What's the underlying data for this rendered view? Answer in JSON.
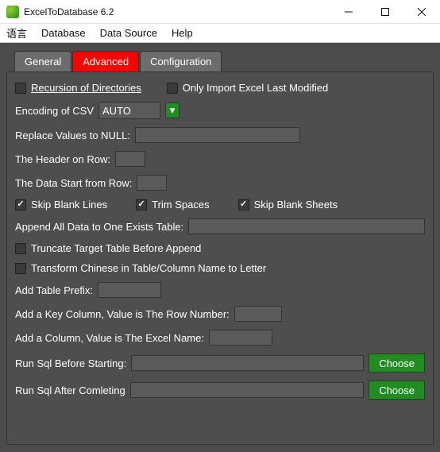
{
  "titlebar": {
    "title": "ExcelToDatabase 6.2"
  },
  "menubar": {
    "items": [
      "语言",
      "Database",
      "Data Source",
      "Help"
    ]
  },
  "tabs": {
    "items": [
      {
        "label": "General",
        "active": false
      },
      {
        "label": "Advanced",
        "active": true
      },
      {
        "label": "Configuration",
        "active": false
      }
    ]
  },
  "advanced": {
    "recursion_label": "Recursion of Directories",
    "only_import_label": "Only Import Excel Last Modified",
    "encoding_label": "Encoding of CSV",
    "encoding_value": "AUTO",
    "replace_null_label": "Replace Values to NULL:",
    "header_row_label": "The Header on Row:",
    "data_start_row_label": "The Data Start from Row:",
    "skip_blank_lines_label": "Skip Blank Lines",
    "trim_spaces_label": "Trim Spaces",
    "skip_blank_sheets_label": "Skip Blank Sheets",
    "append_data_label": "Append All Data to One Exists Table:",
    "truncate_label": "Truncate Target Table Before Append",
    "transform_chinese_label": "Transform Chinese in Table/Column Name to Letter",
    "add_table_prefix_label": "Add Table Prefix:",
    "add_key_col_label": "Add a Key Column, Value is The Row Number:",
    "add_col_excel_label": "Add a Column, Value is The Excel Name:",
    "run_sql_before_label": "Run Sql Before Starting:",
    "run_sql_after_label": "Run Sql After Comleting",
    "choose_label": "Choose",
    "checks": {
      "recursion": false,
      "only_import": false,
      "skip_blank_lines": true,
      "trim_spaces": true,
      "skip_blank_sheets": true,
      "truncate": false,
      "transform_chinese": false
    }
  }
}
